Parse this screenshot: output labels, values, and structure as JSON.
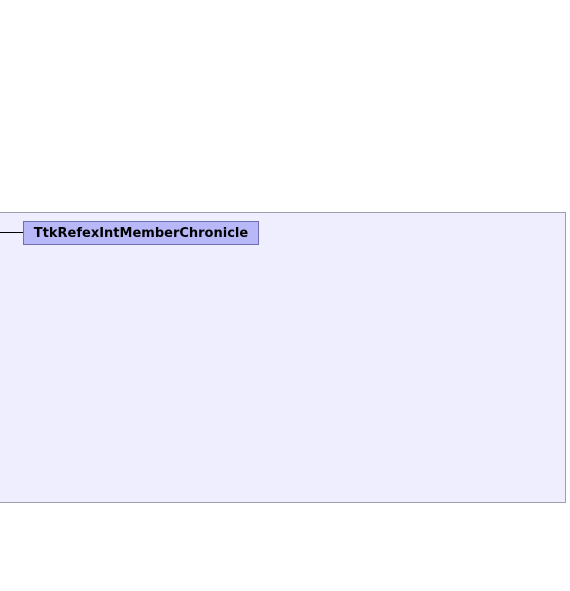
{
  "diagram": {
    "node": {
      "label": "TtkRefexIntMemberChronicle"
    },
    "colors": {
      "panel_background": "#eeeeff",
      "panel_border": "#a0a0b0",
      "node_fill": "#b8b8f8",
      "node_border": "#6f6fb0",
      "connector": "#000000"
    }
  }
}
